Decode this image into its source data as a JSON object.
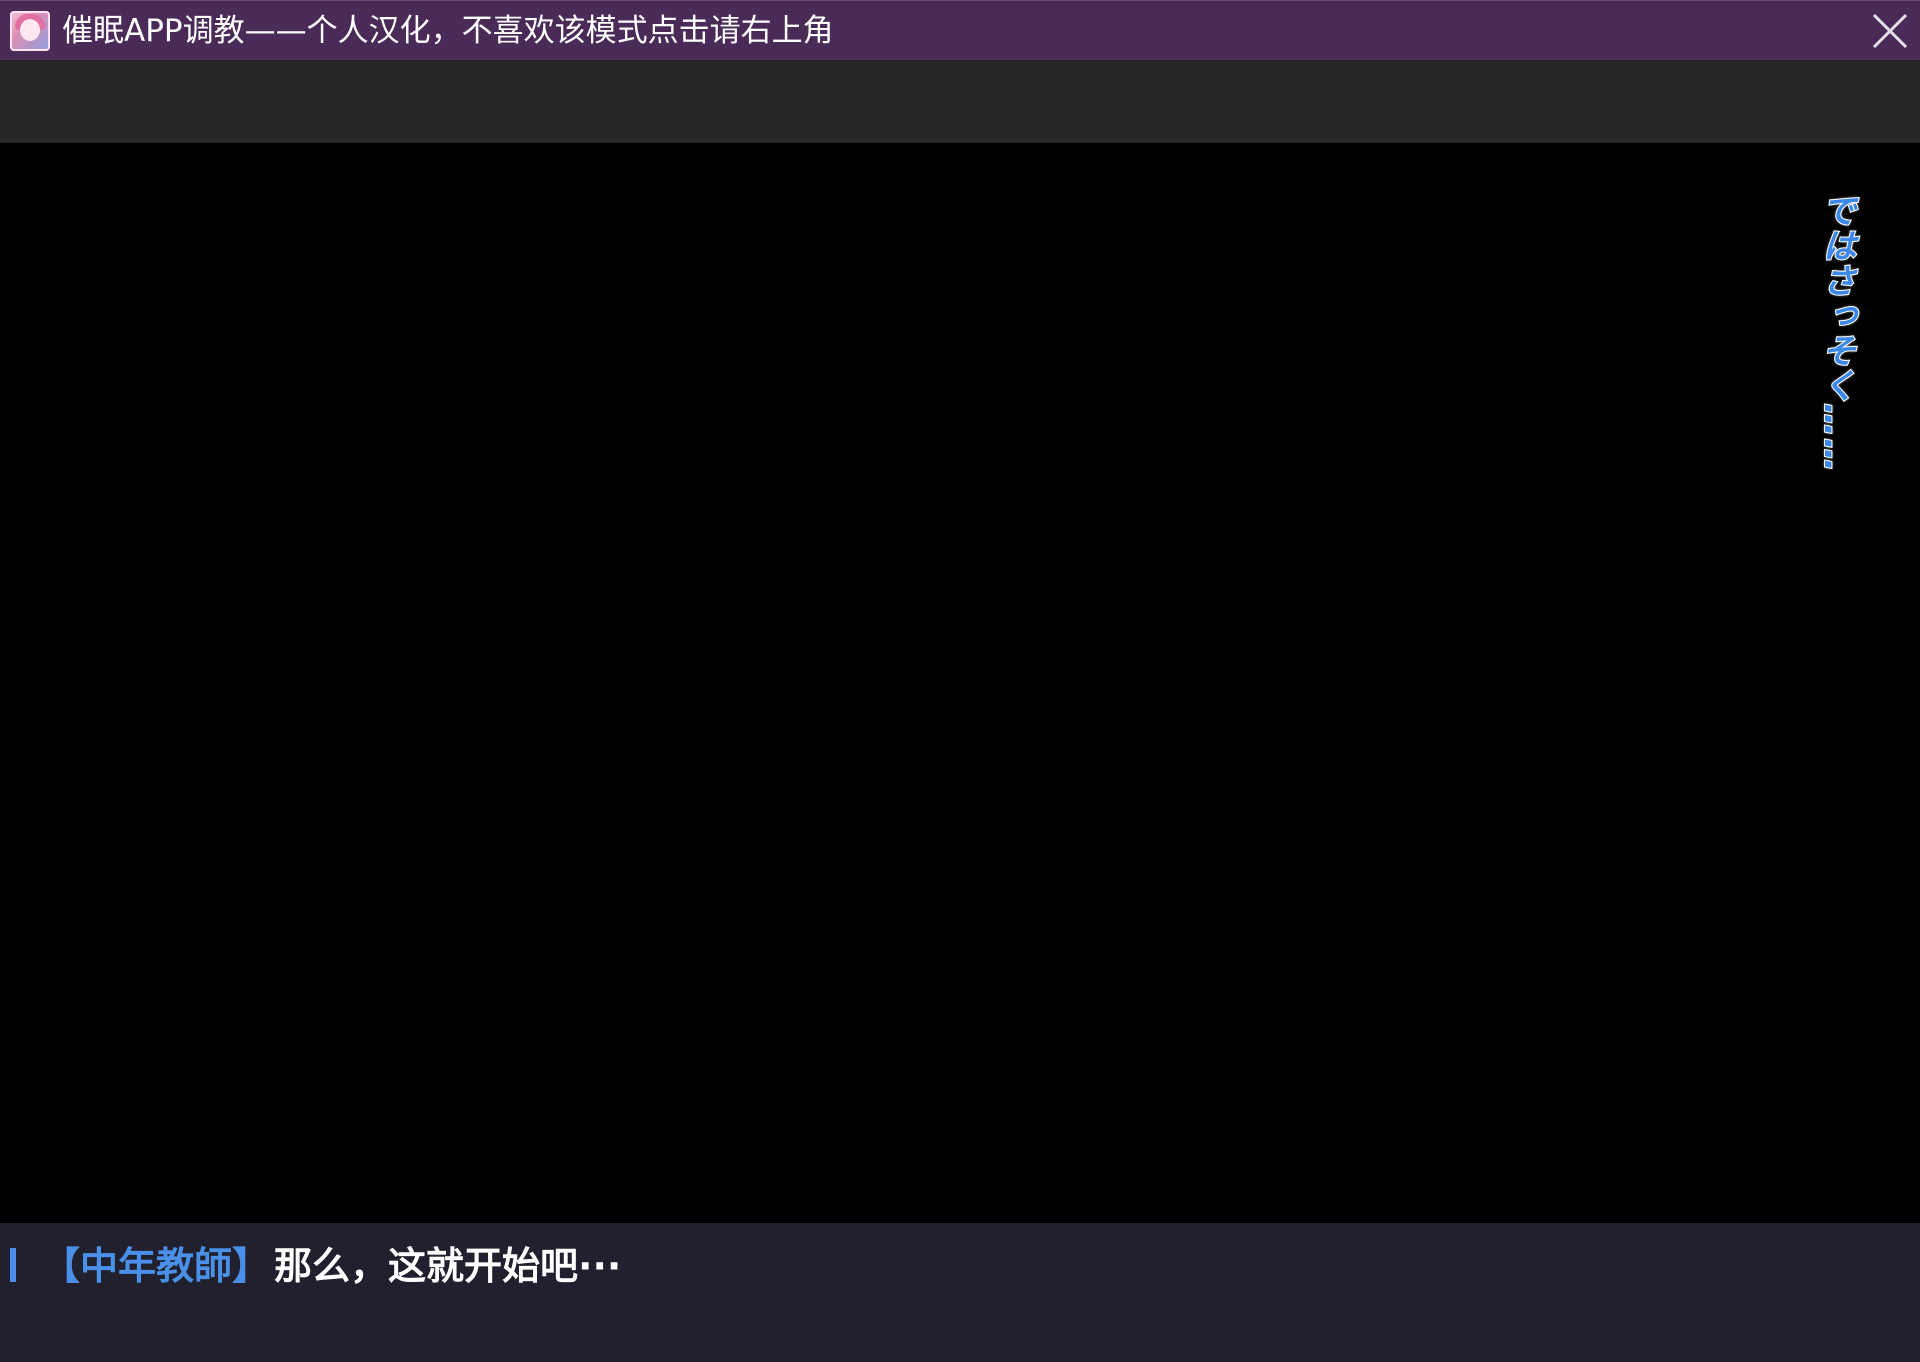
{
  "window": {
    "title": "催眠APP调教——个人汉化，不喜欢该模式点击请右上角",
    "close_icon": "close-x-icon",
    "title_bar_color": "#4a2a57"
  },
  "toolbar": {
    "background_color": "#262626"
  },
  "scene": {
    "vertical_text": "ではさっそく……",
    "vertical_text_color": "#3b88e8"
  },
  "dialog": {
    "open_bracket": "【",
    "speaker": "中年教師",
    "close_bracket": "】",
    "text": "那么，这就开始吧···",
    "accent_color": "#4a90e8",
    "background_color": "#20202e"
  }
}
